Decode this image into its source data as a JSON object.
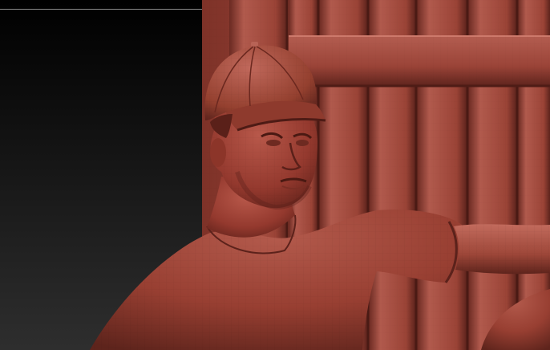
{
  "app": {
    "name": "",
    "document_title": ""
  },
  "viewport": {
    "background_gradient": [
      "#000000",
      "#2e2e2e"
    ],
    "material_base": "#a14b40",
    "material_shadow": "#5c231d",
    "material_highlight": "#d9857a"
  },
  "scene": {
    "subject": "sculpted-figure",
    "elements": [
      "fence",
      "cap",
      "head",
      "torso",
      "arm",
      "knee"
    ]
  }
}
